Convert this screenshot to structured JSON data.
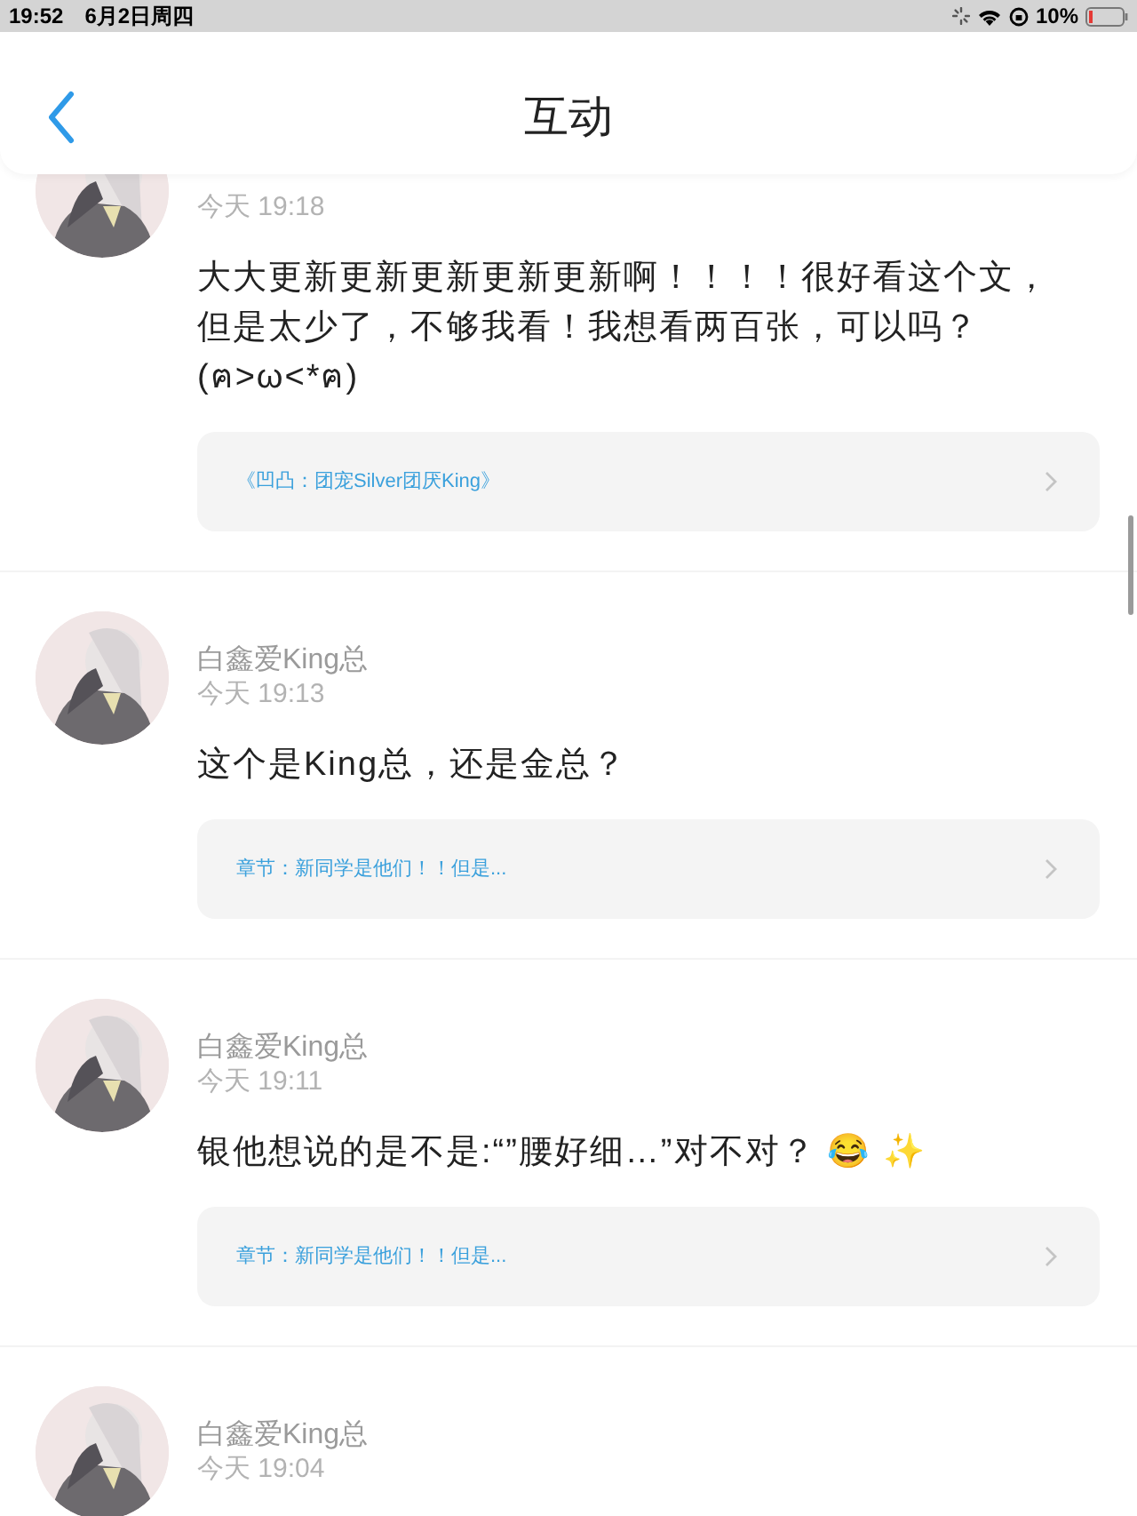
{
  "status_bar": {
    "time": "19:52",
    "date": "6月2日周四",
    "battery": "10%"
  },
  "header": {
    "title": "互动"
  },
  "comments": [
    {
      "time": "今天 19:18",
      "text": "大大更新更新更新更新更新啊！！！！很好看这个文，但是太少了，不够我看！我想看两百张，可以吗？(ฅ>ω<*ฅ)",
      "link": "《凹凸：团宠Silver团厌King》"
    },
    {
      "author": "白鑫爱King总",
      "time": "今天 19:13",
      "text": "这个是King总，还是金总？",
      "link": "章节：新同学是他们！！但是..."
    },
    {
      "author": "白鑫爱King总",
      "time": "今天 19:11",
      "text": "银他想说的是不是:“”腰好细…”对不对？ 😂 ✨",
      "link": "章节：新同学是他们！！但是..."
    },
    {
      "author": "白鑫爱King总",
      "time": "今天 19:04"
    }
  ]
}
